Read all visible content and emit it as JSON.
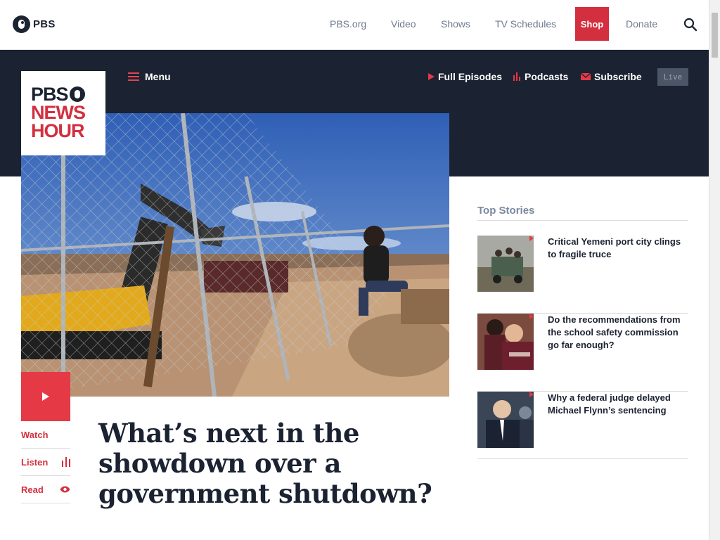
{
  "pbs_bar": {
    "logo_text": "PBS",
    "nav": [
      "PBS.org",
      "Video",
      "Shows",
      "TV Schedules"
    ],
    "shop_label": "Shop",
    "donate_label": "Donate"
  },
  "newshour": {
    "logo_lines": [
      "PBS",
      "NEWS",
      "HOUR"
    ],
    "menu_label": "Menu",
    "subnav": {
      "full_episodes": "Full Episodes",
      "podcasts": "Podcasts",
      "subscribe": "Subscribe"
    },
    "live_label": "Live"
  },
  "article": {
    "headline": "What’s next in the showdown over a government shutdown?",
    "media": {
      "watch": "Watch",
      "listen": "Listen",
      "read": "Read"
    }
  },
  "top_stories": {
    "title": "Top Stories",
    "items": [
      {
        "title": "Critical Yemeni port city clings to fragile truce"
      },
      {
        "title": "Do the recommendations from the school safety commission go far enough?"
      },
      {
        "title": "Why a federal judge delayed Michael Flynn’s sentencing"
      }
    ]
  },
  "colors": {
    "brand_red": "#d32f3f",
    "navy": "#1b2231",
    "muted_blue": "#6f7b8f"
  }
}
